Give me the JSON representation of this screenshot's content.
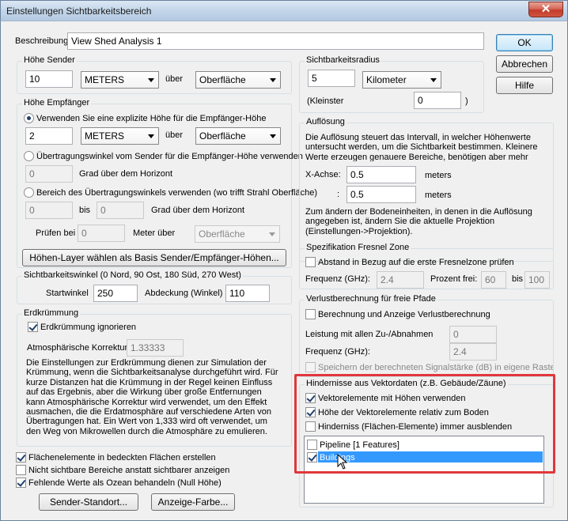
{
  "window": {
    "title": "Einstellungen Sichtbarkeitsbereich",
    "close_glyph": "✕"
  },
  "description": {
    "label": "Beschreibung",
    "value": "View Shed Analysis 1"
  },
  "buttons": {
    "ok": "OK",
    "cancel": "Abbrechen",
    "help": "Hilfe"
  },
  "sender_height": {
    "title": "Höhe Sender",
    "value": "10",
    "unit": "METERS",
    "over": "über",
    "reference": "Oberfläche"
  },
  "receiver_height": {
    "title": "Höhe Empfänger",
    "option_explicit": "Verwenden Sie eine explizite Höhe für die Empfänger-Höhe",
    "value": "2",
    "unit": "METERS",
    "over": "über",
    "reference": "Oberfläche",
    "option_angle": "Übertragungswinkel vom Sender für die Empfänger-Höhe verwenden",
    "angle_value": "0",
    "angle_suffix": "Grad über dem Horizont",
    "option_range": "Bereich des Übertragungswinkels verwenden (wo trifft Strahl Oberfläche)",
    "range_from": "0",
    "range_to_label": "bis",
    "range_to": "0",
    "range_suffix": "Grad über dem Horizont",
    "check_label": "Prüfen bei",
    "check_value": "0",
    "check_meter": "Meter über",
    "check_reference": "Oberfläche"
  },
  "layer_button": "Höhen-Layer wählen als Basis Sender/Empfänger-Höhen...",
  "viewshed_angle": {
    "title": "Sichtbarkeitswinkel (0 Nord, 90 Ost, 180 Süd, 270 West)",
    "start_label": "Startwinkel",
    "start_value": "250",
    "coverage_label": "Abdeckung (Winkel)",
    "coverage_value": "110"
  },
  "curvature": {
    "title": "Erdkrümmung",
    "ignore_label": "Erdkrümmung ignorieren",
    "atmo_label": "Atmosphärische Korrektur",
    "atmo_value": "1.33333",
    "description": "Die Einstellungen zur Erdkrümmung dienen zur Simulation der Krümmung, wenn die Sichtbarkeitsanalyse durchgeführt wird. Für kurze Distanzen hat die Krümmung in der Regel keinen Einfluss auf das Ergebnis, aber die Wirkung über große Entfernungen kann Atmosphärische Korrektur wird verwendet, um den Effekt ausmachen, die die Erdatmosphäre auf verschiedene Arten von Übertragungen hat. Ein Wert von 1,333 wird oft verwendet, um den Weg von Mikrowellen durch die Atmosphäre zu emulieren."
  },
  "bottom_checks": {
    "area_features": "Flächenelemente in bedeckten Flächen erstellen",
    "show_invisible": "Nicht sichtbare Bereiche anstatt sichtbarer anzeigen",
    "missing_ocean": "Fehlende Werte als Ozean behandeln (Null Höhe)"
  },
  "bottom_buttons": {
    "sender_location": "Sender-Standort...",
    "display_color": "Anzeige-Farbe..."
  },
  "radius": {
    "title": "Sichtbarkeitsradius",
    "value": "5",
    "unit": "Kilometer",
    "min_label": "(Kleinster",
    "min_value": "0",
    "min_close": ")"
  },
  "resolution": {
    "title": "Auflösung",
    "text1": "Die Auflösung steuert das Intervall, in welcher Höhenwerte untersucht werden, um die Sichtbarkeit bestimmen. Kleinere Werte erzeugen genauere Bereiche, benötigen aber mehr Rechenzeit.",
    "x_label": "X-Achse:",
    "x_value": "0.5",
    "x_unit": "meters",
    "y_label": ":",
    "y_value": "0.5",
    "y_unit": "meters",
    "text2": "Zum ändern der Bodeneinheiten, in denen in die Auflösung angegeben ist, ändern Sie die aktuelle Projektion (Einstellungen->Projektion)."
  },
  "fresnel": {
    "title": "Spezifikation Fresnel Zone",
    "check_label": "Abstand in Bezug auf die erste Fresnelzone prüfen",
    "freq_label": "Frequenz (GHz):",
    "freq_value": "2.4",
    "percent_label": "Prozent frei:",
    "percent_value": "60",
    "to_label": "bis",
    "to_value": "100"
  },
  "loss": {
    "title": "Verlustberechnung für freie Pfade",
    "check_label": "Berechnung und Anzeige Verlustberechnung",
    "power_label": "Leistung mit allen Zu-/Abnahmen",
    "power_value": "0",
    "freq_label": "Frequenz (GHz):",
    "freq_value": "2.4",
    "save_label": "Speichern der berechneten Signalstärke (dB) in eigene Rasterebe"
  },
  "obstacles": {
    "title": "Hindernisse aus Vektordaten  (z.B. Gebäude/Zäune)",
    "use_heights": "Vektorelemente mit Höhen verwenden",
    "relative": "Höhe der Vektorelemente relativ zum Boden",
    "hide_areas": "Hinderniss (Flächen-Elemente) immer ausblenden",
    "layers": [
      {
        "label": "Pipeline [1 Features]",
        "checked": false,
        "selected": false
      },
      {
        "label": "Buildings",
        "checked": true,
        "selected": true
      }
    ]
  },
  "colors": {
    "highlight": "#e0373b",
    "selection": "#3399ff",
    "accent": "#3c7fb1"
  }
}
